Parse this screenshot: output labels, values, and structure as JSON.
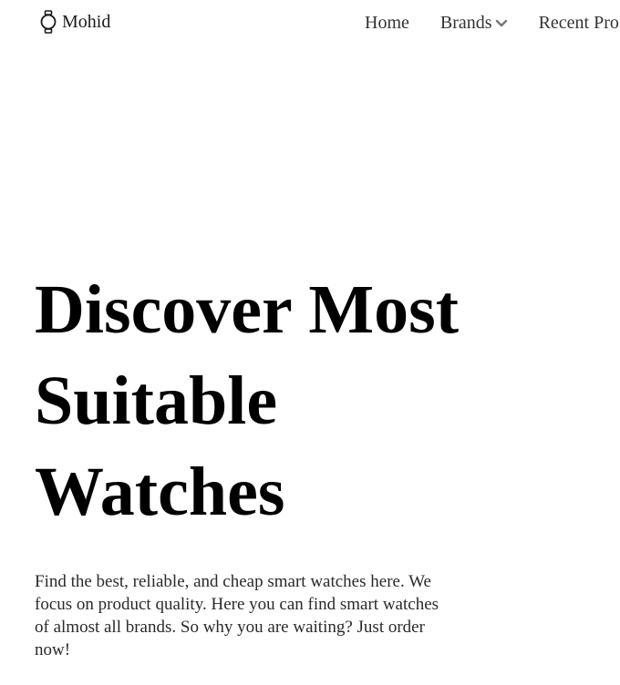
{
  "header": {
    "logo_text": "Mohid",
    "logo_icon": "watch-icon",
    "nav": {
      "home": "Home",
      "brands": "Brands",
      "recent": "Recent Pro"
    }
  },
  "hero": {
    "title_lines": [
      "Discover Most",
      "Suitable",
      "Watches"
    ],
    "description": "Find the best, reliable, and cheap smart watches here. We focus on product quality. Here you can find smart watches of almost all brands. So why you are waiting? Just order now!"
  },
  "colors": {
    "text": "#1a1a1a",
    "nav_text": "#333333",
    "chevron": "#777777",
    "background": "#ffffff"
  }
}
